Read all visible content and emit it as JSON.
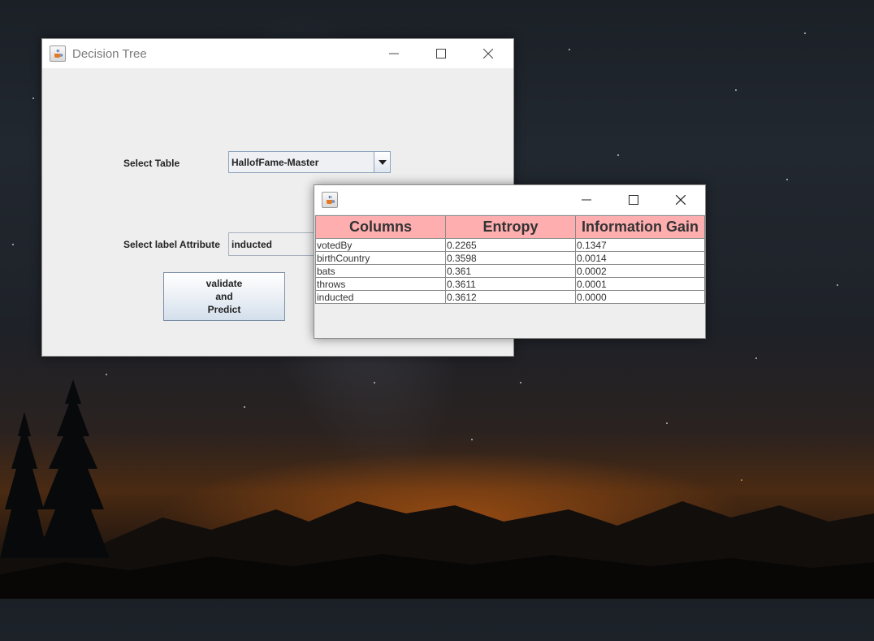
{
  "main_window": {
    "title": "Decision Tree",
    "select_table_label": "Select Table",
    "select_table_value": "HallofFame-Master",
    "select_label_attribute_label": "Select label Attribute",
    "label_attribute_value": "inducted",
    "predict_button": [
      "validate",
      "and",
      "Predict"
    ]
  },
  "result_window": {
    "title": "",
    "table": {
      "headers": [
        "Columns",
        "Entropy",
        "Information Gain"
      ],
      "rows": [
        [
          "votedBy",
          "0.2265",
          "0.1347"
        ],
        [
          "birthCountry",
          "0.3598",
          "0.0014"
        ],
        [
          "bats",
          "0.361",
          "0.0002"
        ],
        [
          "throws",
          "0.3611",
          "0.0001"
        ],
        [
          "inducted",
          "0.3612",
          "0.0000"
        ]
      ]
    }
  },
  "colors": {
    "table_header_bg": "#ffaeb0",
    "window_bg": "#eeeeee"
  },
  "icons": {
    "app_icon": "java-coffee-cup-icon",
    "minimize": "minimize-icon",
    "maximize": "maximize-icon",
    "close": "close-icon",
    "dropdown": "chevron-down-icon"
  }
}
